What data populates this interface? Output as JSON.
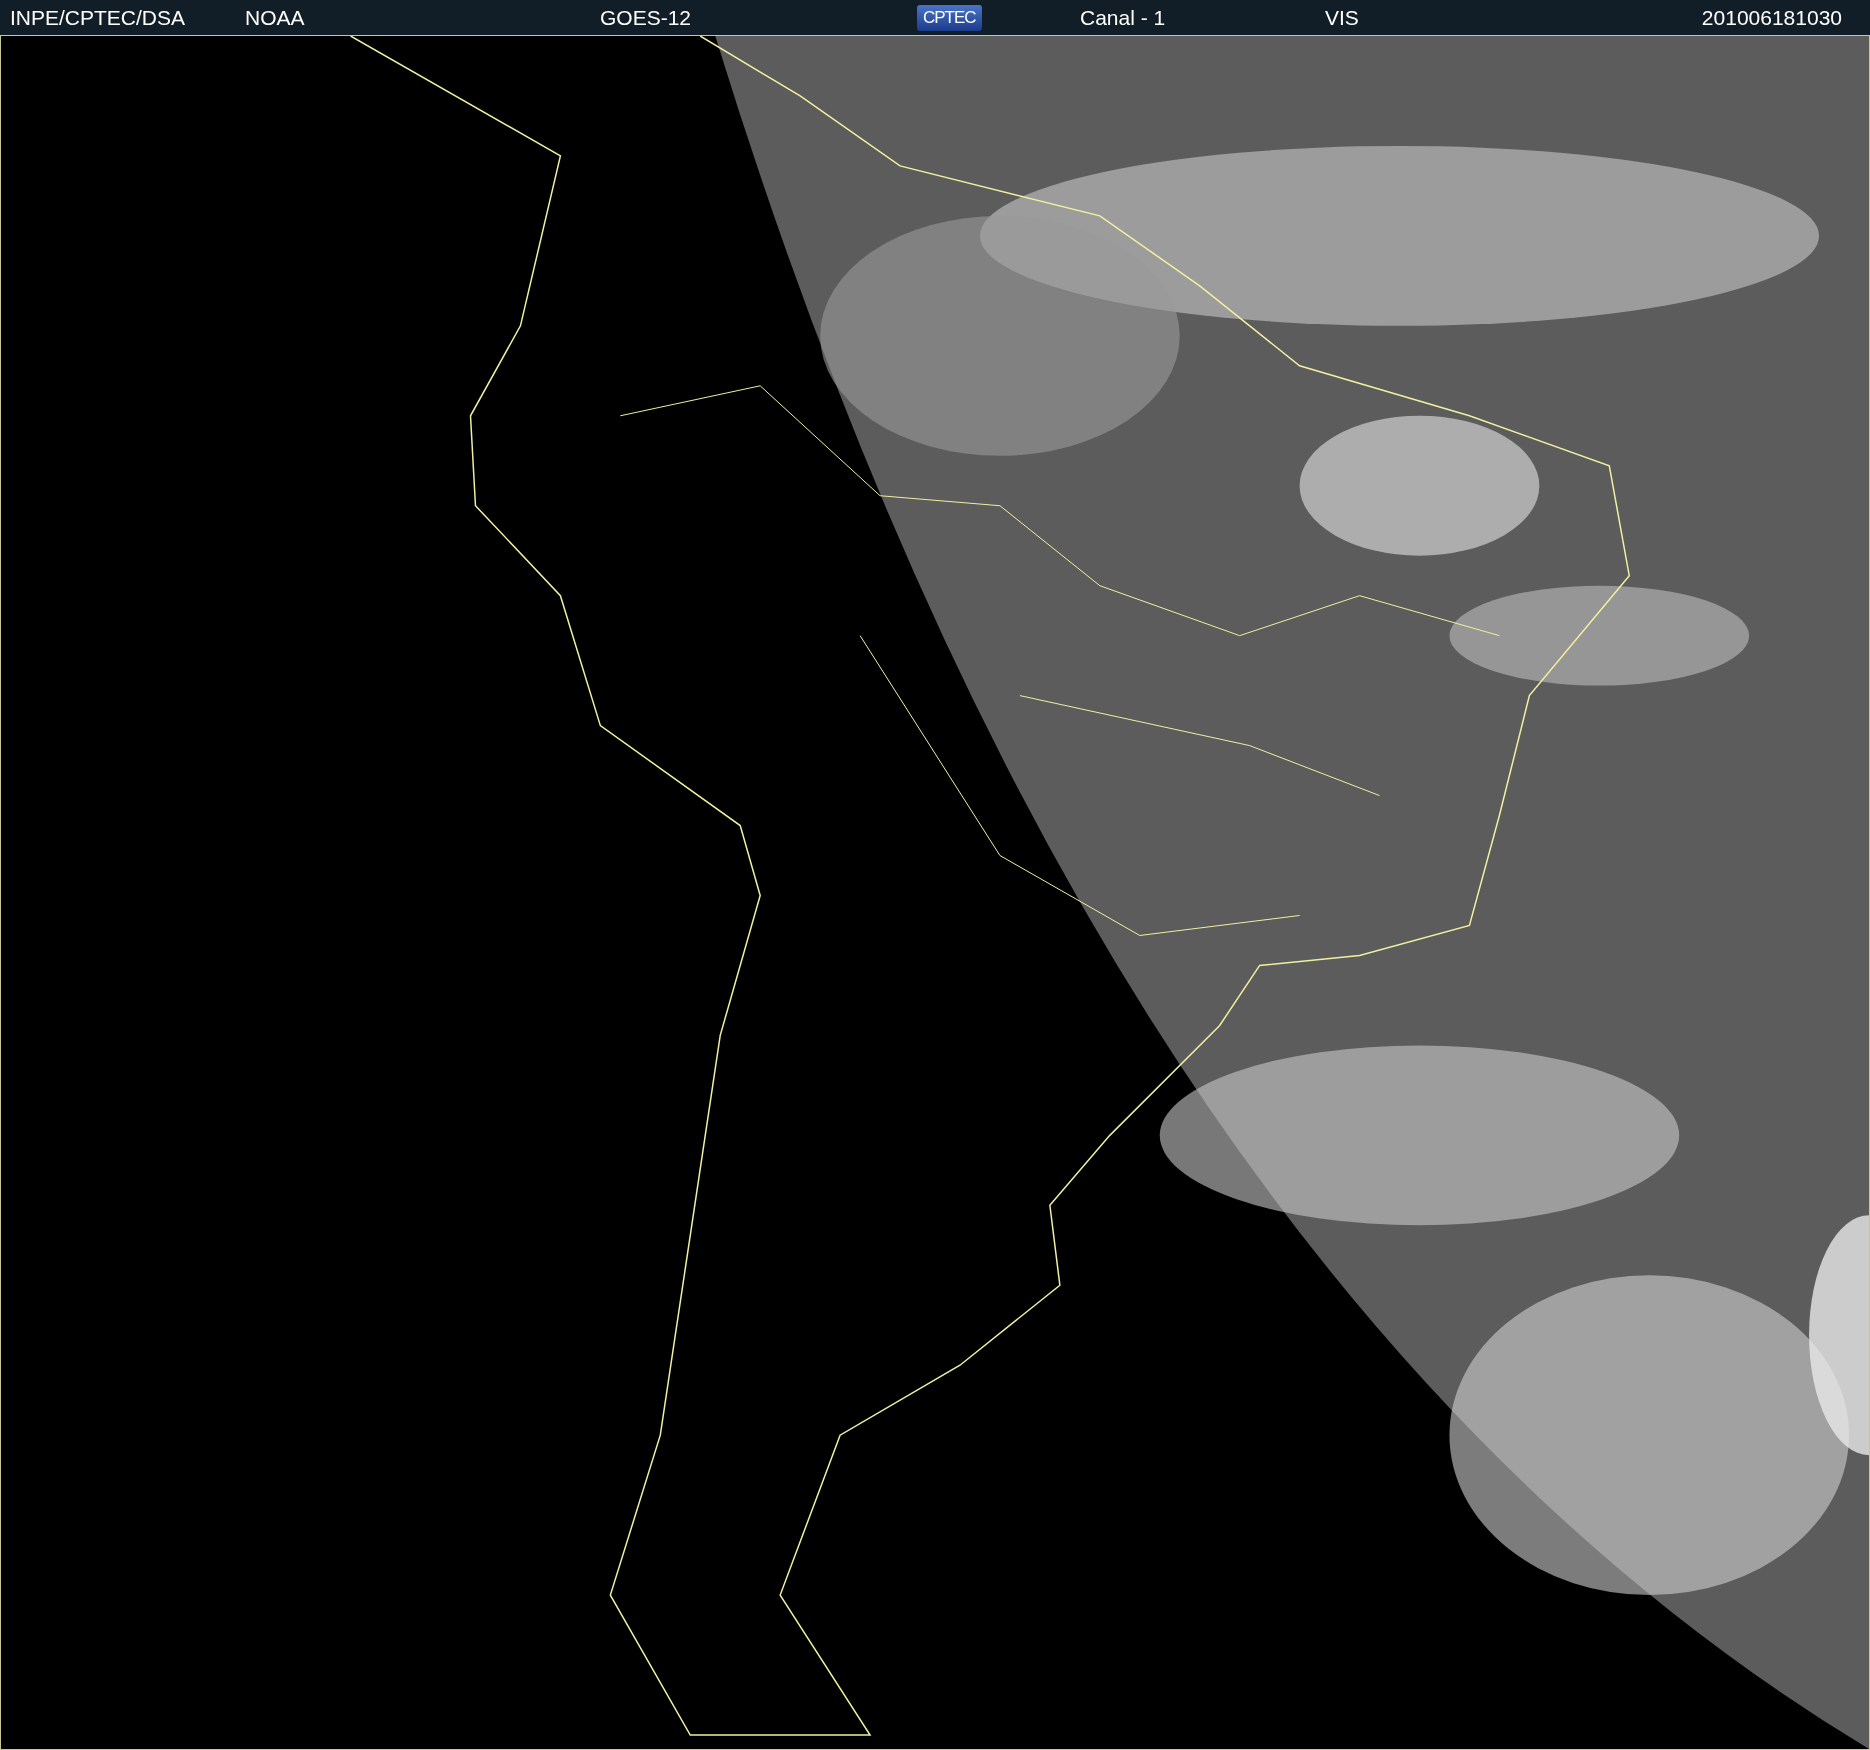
{
  "header": {
    "items": [
      {
        "kind": "text",
        "text": "INPE/CPTEC/DSA"
      },
      {
        "kind": "text",
        "text": "NOAA"
      },
      {
        "kind": "text",
        "text": "GOES-12"
      },
      {
        "kind": "logo",
        "text": "CPTEC"
      },
      {
        "kind": "text",
        "text": "Canal - 1"
      },
      {
        "kind": "text",
        "text": "VIS"
      },
      {
        "kind": "text",
        "text": "201006181030"
      }
    ]
  }
}
